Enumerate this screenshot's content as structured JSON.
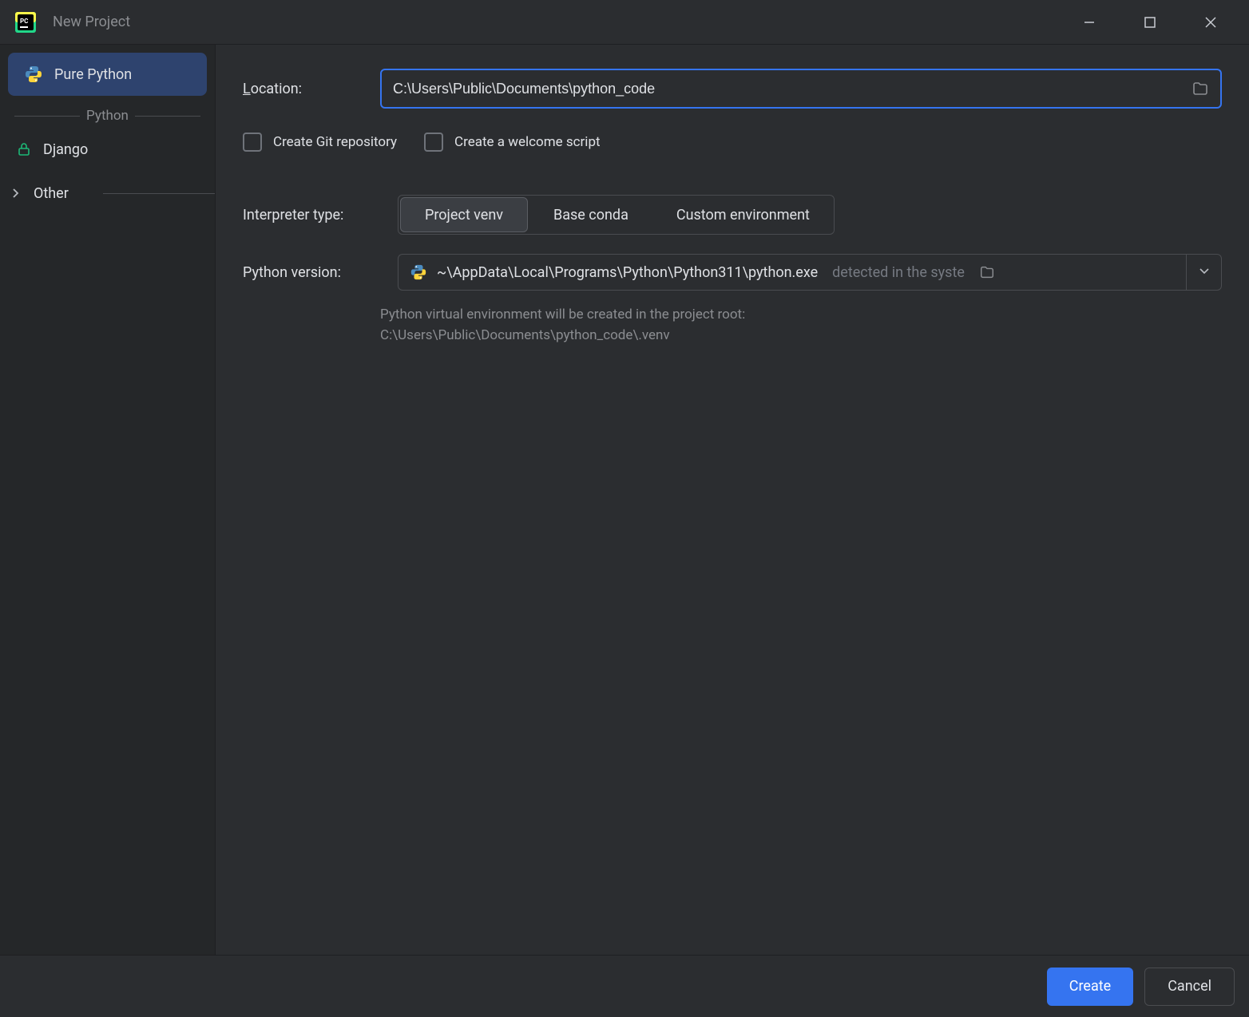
{
  "window": {
    "title": "New Project"
  },
  "sidebar": {
    "items": [
      {
        "label": "Pure Python",
        "selected": true
      },
      {
        "label": "Django",
        "selected": false
      }
    ],
    "group_label": "Python",
    "other_label": "Other"
  },
  "form": {
    "location_label": "Location:",
    "location_value": "C:\\Users\\Public\\Documents\\python_code",
    "git_checkbox": "Create Git repository",
    "welcome_checkbox": "Create a welcome script",
    "interpreter_label": "Interpreter type:",
    "interpreter_options": [
      {
        "label": "Project venv",
        "selected": true
      },
      {
        "label": "Base conda",
        "selected": false
      },
      {
        "label": "Custom environment",
        "selected": false
      }
    ],
    "python_version_label": "Python version:",
    "python_version_path": "~\\AppData\\Local\\Programs\\Python\\Python311\\python.exe",
    "python_version_suffix": "detected in the syste",
    "helper_line1": "Python virtual environment will be created in the project root:",
    "helper_line2": "C:\\Users\\Public\\Documents\\python_code\\.venv"
  },
  "footer": {
    "create": "Create",
    "cancel": "Cancel"
  }
}
